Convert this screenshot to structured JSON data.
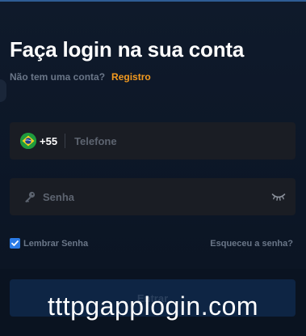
{
  "login": {
    "title": "Faça login na sua conta",
    "no_account_text": "Não tem uma conta?",
    "register_link": "Registro",
    "phone": {
      "flag_icon": "brazil-flag-icon",
      "country_code": "+55",
      "placeholder": "Telefone",
      "value": ""
    },
    "password": {
      "leading_icon": "key-icon",
      "placeholder": "Senha",
      "value": "",
      "toggle_icon": "eye-closed-icon"
    },
    "remember": {
      "label": "Lembrar Senha",
      "checked": true
    },
    "forgot_link": "Esqueceu a senha?",
    "submit_label": "Entrar"
  },
  "watermark": {
    "text": "tttpgapplogin.com"
  },
  "colors": {
    "background": "#0f1a2b",
    "accent_link": "#f39a1f",
    "field_background": "#1a1d24",
    "checkbox": "#2b7be6",
    "submit_button": "#12305a"
  }
}
